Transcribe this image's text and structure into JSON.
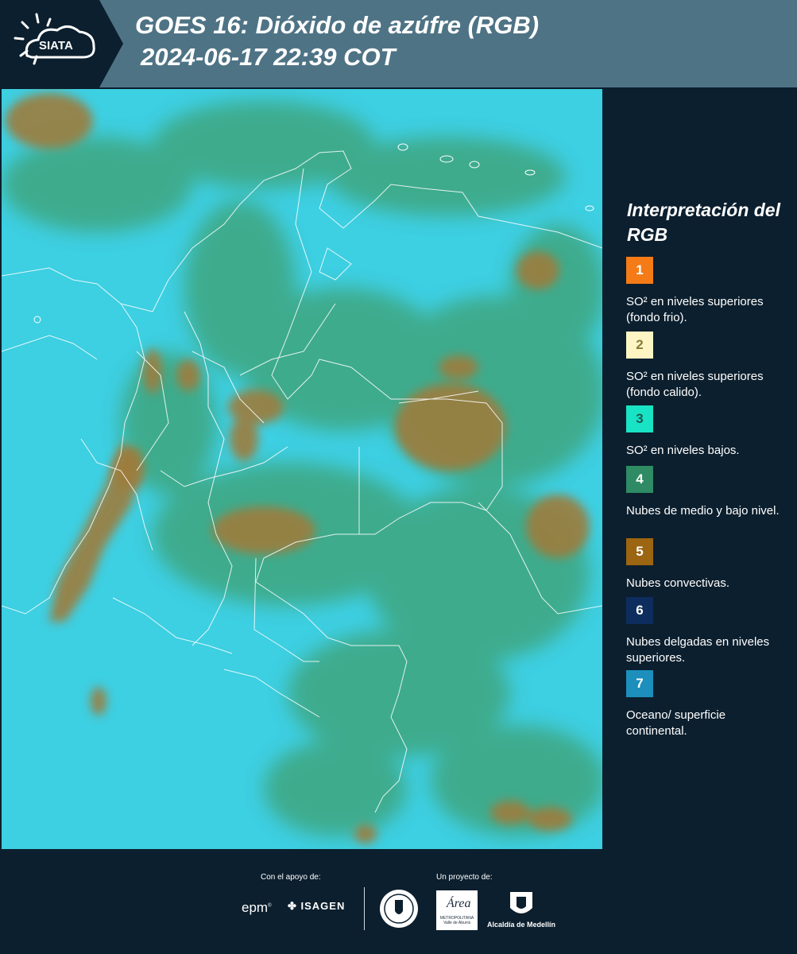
{
  "header": {
    "logo_text": "SIATA",
    "title_line1": "GOES 16: Dióxido de azúfre (RGB)",
    "title_line2": "2024-06-17 22:39 COT"
  },
  "legend": {
    "title": "Interpretación del RGB",
    "items": [
      {
        "number": "1",
        "color": "#f47b16",
        "text": "SO² en niveles superiores (fondo frio)."
      },
      {
        "number": "2",
        "color": "#fdf6c4",
        "text": "SO² en niveles superiores (fondo calido)."
      },
      {
        "number": "3",
        "color": "#18e3c4",
        "text": "SO² en niveles bajos."
      },
      {
        "number": "4",
        "color": "#2e8b63",
        "text": "Nubes de medio y bajo nivel."
      },
      {
        "number": "5",
        "color": "#9c6512",
        "text": "Nubes convectivas."
      },
      {
        "number": "6",
        "color": "#0d2d5e",
        "text": "Nubes delgadas en niveles superiores."
      },
      {
        "number": "7",
        "color": "#1c8fbd",
        "text": "Oceano/ superficie continental."
      }
    ]
  },
  "footer": {
    "support_label": "Con el apoyo de:",
    "project_label": "Un proyecto de:",
    "epm_logo": "epm",
    "isagen_logo": "ISAGEN",
    "area_logo_text": "Área",
    "area_logo_sub": "METROPOLITANA Valle de Aburrá",
    "alcaldia_label": "Alcaldía de Medellín"
  }
}
